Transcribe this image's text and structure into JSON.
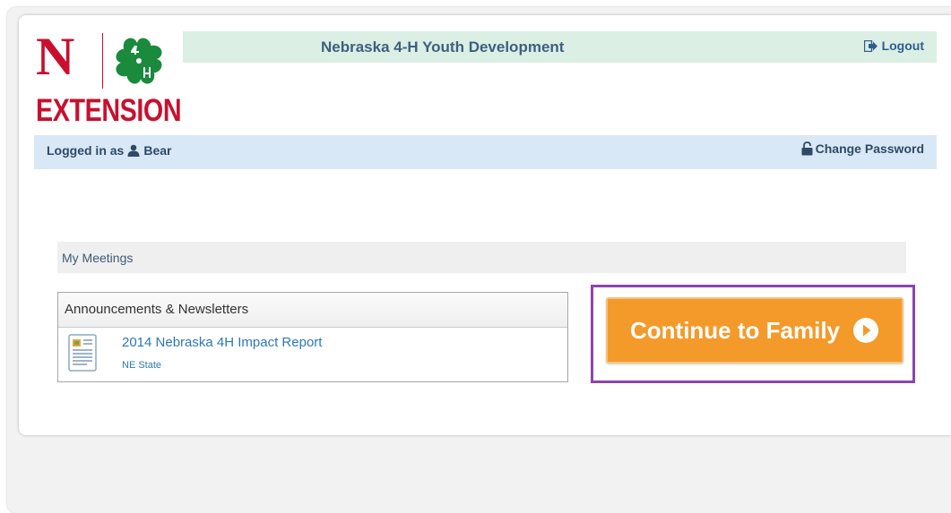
{
  "brand": {
    "logo_letter": "N",
    "logo_word": "EXTENSION",
    "primary_color": "#c8102e",
    "clover_color": "#1a8a3c"
  },
  "header": {
    "title": "Nebraska 4-H Youth Development",
    "logout_label": "Logout",
    "logout_icon": "logout-icon"
  },
  "user_bar": {
    "logged_in_prefix": "Logged in as",
    "user_icon": "user-icon",
    "username": "Bear",
    "lock_icon": "unlock-icon",
    "change_password_label": "Change Password"
  },
  "meetings": {
    "label": "My Meetings"
  },
  "announcements": {
    "title": "Announcements & Newsletters",
    "items": [
      {
        "icon": "document-icon",
        "title": "2014 Nebraska 4H Impact Report",
        "source": "NE State"
      }
    ]
  },
  "continue": {
    "label": "Continue to Family",
    "icon": "play-circle-icon",
    "button_color": "#f39a2b",
    "highlight_color": "#8e44ad"
  }
}
